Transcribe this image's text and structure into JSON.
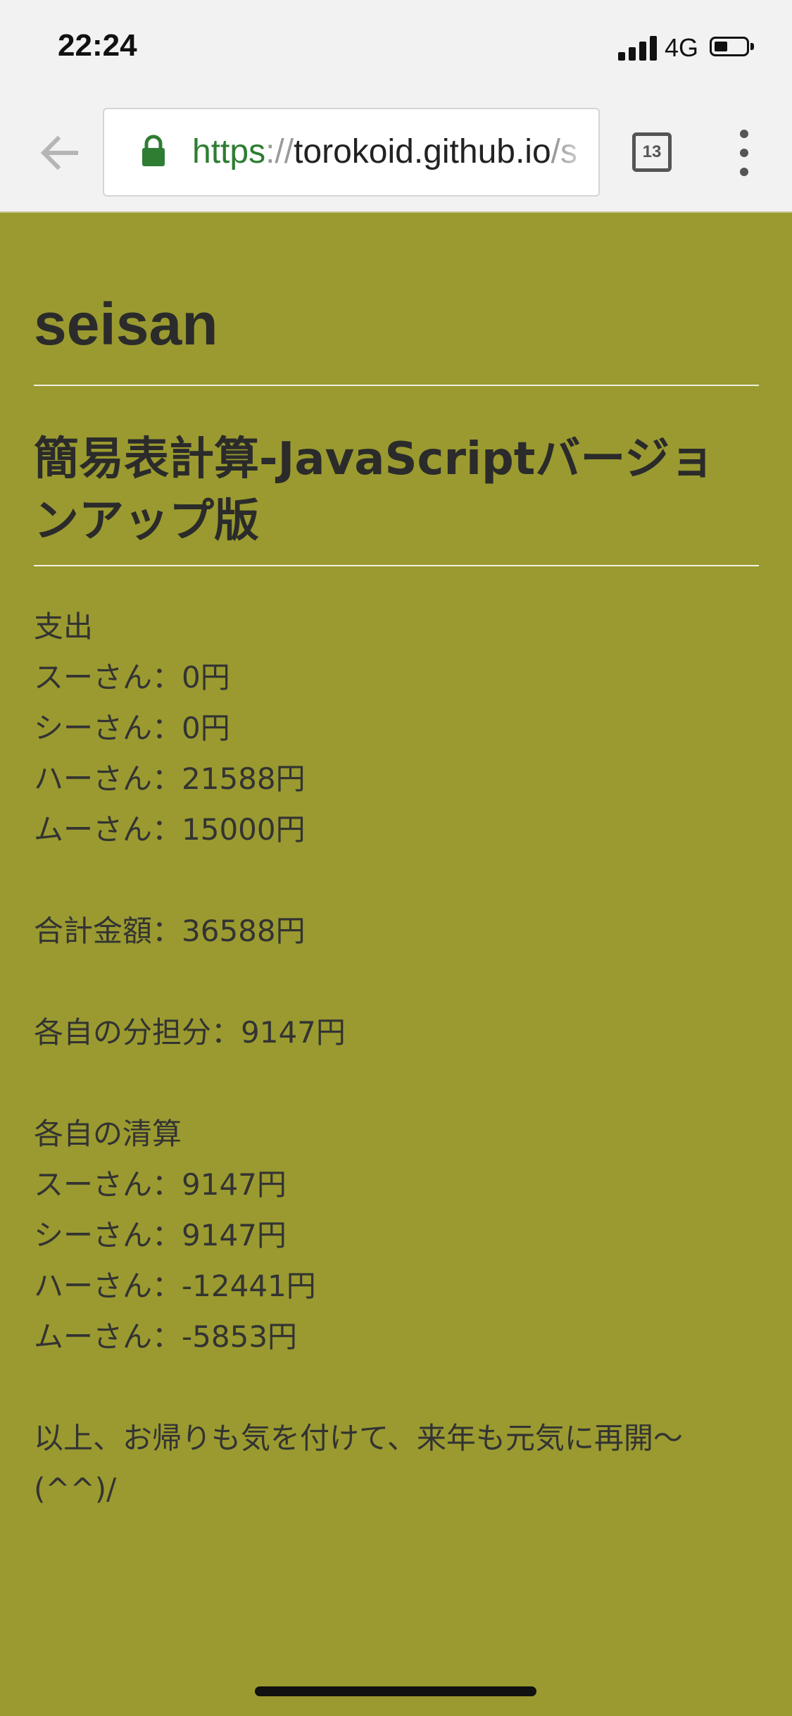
{
  "status_bar": {
    "time": "22:24",
    "network": "4G",
    "signal_icon": "signal-bars-icon",
    "battery_icon": "battery-icon"
  },
  "toolbar": {
    "back_icon": "arrow-left-icon",
    "url_scheme": "https",
    "url_sep": "://",
    "url_host": "torokoid.github.io",
    "url_path": "/s",
    "lock_icon": "lock-icon",
    "tab_count": "13",
    "menu_icon": "kebab-menu-icon"
  },
  "page": {
    "site_title": "seisan",
    "heading": "簡易表計算-JavaScriptバージョンアップ版",
    "expenses": {
      "label": "支出",
      "items": [
        "スーさん：0円",
        "シーさん：0円",
        "ハーさん：21588円",
        "ムーさん：15000円"
      ]
    },
    "total": "合計金額：36588円",
    "share": "各自の分担分：9147円",
    "settlement": {
      "label": "各自の清算",
      "items": [
        "スーさん：9147円",
        "シーさん：9147円",
        "ハーさん：-12441円",
        "ムーさん：-5853円"
      ]
    },
    "closing": "以上、お帰りも気を付けて、来年も元気に再開〜(^^)/"
  },
  "colors": {
    "page_background": "#9a9a30",
    "chrome_background": "#f2f2f2",
    "url_scheme": "#2e7d32"
  }
}
